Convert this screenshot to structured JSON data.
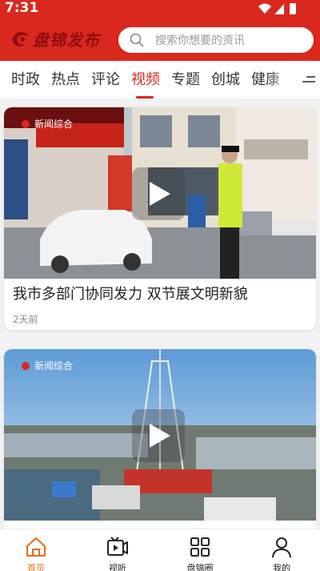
{
  "status": {
    "time": "7:31"
  },
  "header": {
    "logo_text": "盘锦发布",
    "search_placeholder": "搜索你想要的资讯"
  },
  "tabs": [
    {
      "label": "时政",
      "active": false
    },
    {
      "label": "热点",
      "active": false
    },
    {
      "label": "评论",
      "active": false
    },
    {
      "label": "视频",
      "active": true
    },
    {
      "label": "专题",
      "active": false
    },
    {
      "label": "创城",
      "active": false
    },
    {
      "label": "健康",
      "active": false
    }
  ],
  "feed": [
    {
      "title": "我市多部门协同发力  双节展文明新貌",
      "time": "2天前",
      "watermark": "新闻综合",
      "type": "video"
    },
    {
      "title": "",
      "time": "",
      "watermark": "新闻综合",
      "type": "video"
    }
  ],
  "bottom_nav": [
    {
      "label": "首页",
      "icon": "home-icon",
      "active": true
    },
    {
      "label": "视听",
      "icon": "video-icon",
      "active": false
    },
    {
      "label": "盘锦圈",
      "icon": "grid-icon",
      "active": false
    },
    {
      "label": "我的",
      "icon": "user-icon",
      "active": false
    }
  ],
  "colors": {
    "brand": "#d9281e",
    "nav_active": "#e86a14"
  }
}
